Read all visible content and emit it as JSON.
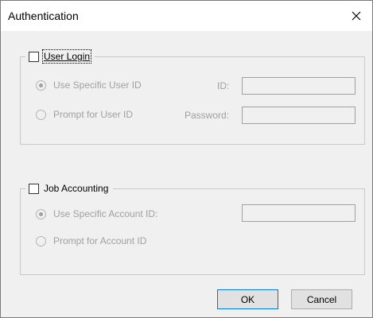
{
  "window": {
    "title": "Authentication"
  },
  "user_login": {
    "label": "User Login",
    "checked": false,
    "options": [
      {
        "label": "Use Specific User ID",
        "selected": true
      },
      {
        "label": "Prompt for User ID",
        "selected": false
      }
    ],
    "id_label": "ID:",
    "id_value": "",
    "password_label": "Password:",
    "password_value": ""
  },
  "job_accounting": {
    "label": "Job Accounting",
    "checked": false,
    "options": [
      {
        "label": "Use Specific Account ID:",
        "selected": true
      },
      {
        "label": "Prompt for Account ID",
        "selected": false
      }
    ],
    "account_value": ""
  },
  "buttons": {
    "ok": "OK",
    "cancel": "Cancel"
  },
  "icons": {
    "close": "close-icon"
  },
  "colors": {
    "disabled_text": "#a0a0a0",
    "focus_border": "#0078d7"
  }
}
